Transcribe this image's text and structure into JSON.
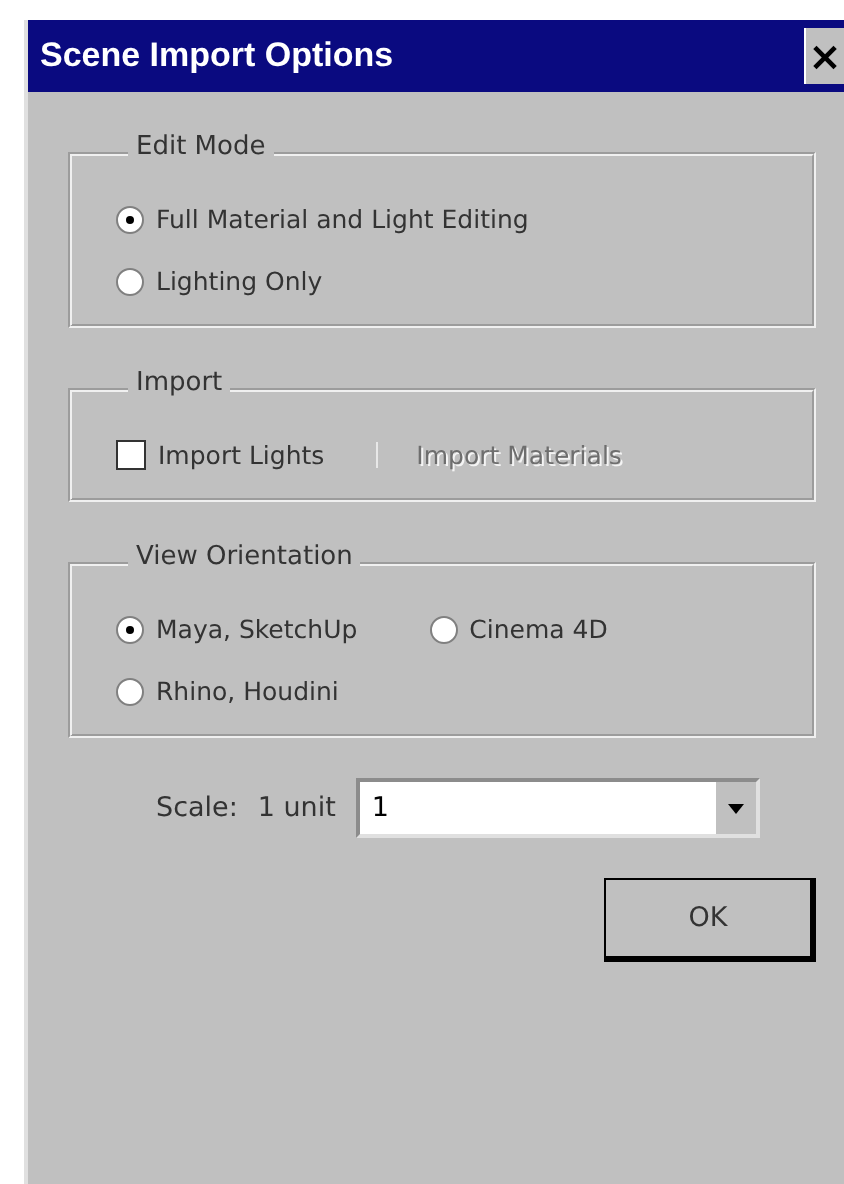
{
  "window": {
    "title": "Scene Import Options",
    "close_label": "×"
  },
  "edit_mode": {
    "title": "Edit Mode",
    "options": [
      {
        "label": "Full Material and Light Editing",
        "selected": true
      },
      {
        "label": "Lighting Only",
        "selected": false
      }
    ]
  },
  "import": {
    "title": "Import",
    "checkboxes": [
      {
        "label": "Import Lights",
        "checked": false,
        "disabled": false
      },
      {
        "label": "Import Materials",
        "checked": false,
        "disabled": true
      }
    ]
  },
  "view_orientation": {
    "title": "View Orientation",
    "options": [
      {
        "label": "Maya, SketchUp",
        "selected": true
      },
      {
        "label": "Cinema 4D",
        "selected": false
      },
      {
        "label": "Rhino, Houdini",
        "selected": false
      }
    ]
  },
  "scale": {
    "label": "Scale:",
    "unit_label": "1 unit",
    "value": "1"
  },
  "buttons": [
    "OK"
  ]
}
